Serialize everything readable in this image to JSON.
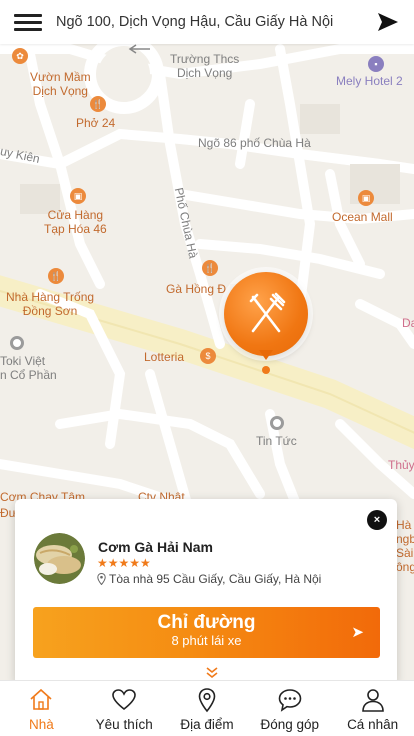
{
  "header": {
    "address": "Ngõ 100, Dịch Vọng Hậu, Cầu Giấy Hà Nội",
    "menu_icon": "hamburger-icon",
    "send_icon": "send-arrow-icon"
  },
  "map": {
    "labels": {
      "truong_thcs": "Trường Thcs\nDịch Vọng",
      "mely_hotel": "Mely Hotel 2",
      "vuong_mam": "Vườn Mầm\nDịch Vọng",
      "pho24": "Phở 24",
      "ngo86": "Ngõ 86 phố Chùa Hà",
      "duy_kien": "uy Kiên",
      "pho_chua_ha": "Phố Chùa Hà",
      "ocean_mall": "Ocean Mall",
      "cua_hang": "Cửa Hàng\nTạp Hóa 46",
      "nha_hang_trong": "Nhà Hàng Trống\nĐồng Sơn",
      "ga_hong": "Gà Hồng Đ",
      "toki": "Toki Việt\nn Cổ Phần",
      "lotteria": "Lotteria",
      "tin_tuc": "Tin Tức",
      "thuy": "Thủy",
      "da": "Da",
      "com_chay": "Cơm Chay Tâm",
      "ctv_nhat": "Ctv Nhật",
      "duong": "Đườ",
      "right_edge": "Hà\nngbi\nSài\nông"
    }
  },
  "marker": {
    "icon": "fork-knife-icon",
    "color": "#f07612"
  },
  "card": {
    "name": "Cơm Gà Hải Nam",
    "rating": 5,
    "stars": "★★★★★",
    "address": "Tòa nhà 95 Cầu Giấy, Cầu Giấy, Hà Nội",
    "directions_label": "Chỉ đường",
    "eta": "8 phút lái xe",
    "arrow": "➤",
    "close": "×"
  },
  "nav": {
    "items": [
      {
        "label": "Nhà",
        "icon": "home-icon",
        "active": true
      },
      {
        "label": "Yêu thích",
        "icon": "heart-icon",
        "active": false
      },
      {
        "label": "Địa điểm",
        "icon": "location-pin-icon",
        "active": false
      },
      {
        "label": "Đóng góp",
        "icon": "chat-bubble-icon",
        "active": false
      },
      {
        "label": "Cá nhân",
        "icon": "person-icon",
        "active": false
      }
    ]
  },
  "colors": {
    "accent": "#f07a1a",
    "gradient_start": "#f7a21e",
    "gradient_end": "#f26a0a"
  }
}
